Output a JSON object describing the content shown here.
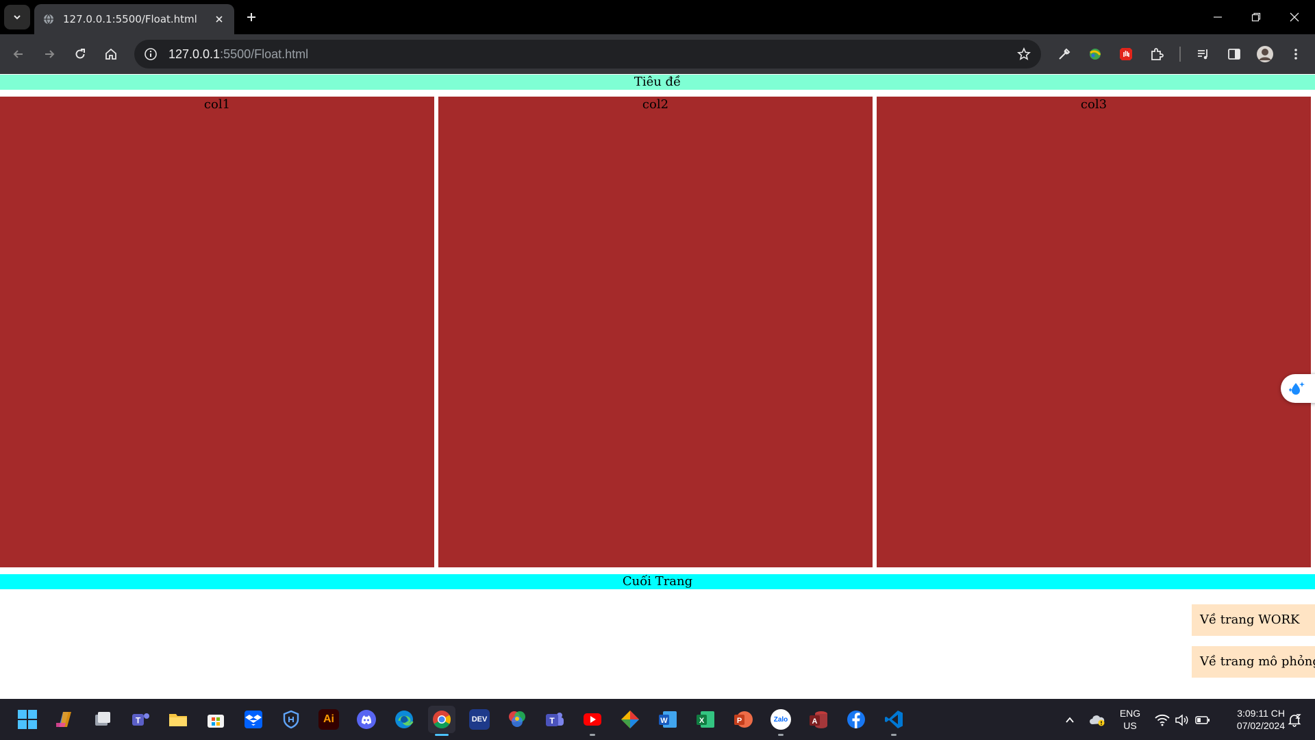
{
  "browser": {
    "tab": {
      "title": "127.0.0.1:5500/Float.html"
    },
    "address_bar": {
      "host": "127.0.0.1",
      "rest": ":5500/Float.html"
    }
  },
  "page": {
    "header": "Tiêu đề",
    "columns": [
      "col1",
      "col2",
      "col3"
    ],
    "footer": "Cuối Trang",
    "links": [
      "Về trang WORK",
      "Về trang mô phỏng"
    ],
    "colors": {
      "header": "#7fffd4",
      "column": "#a52a2a",
      "footer": "#00ffff",
      "link_bg": "#ffe4c4"
    }
  },
  "taskbar": {
    "apps": [
      "windows-start",
      "copilot",
      "task-view",
      "teams",
      "file-explorer",
      "microsoft-store",
      "dropbox",
      "vpn",
      "illustrator",
      "discord",
      "edge",
      "chrome",
      "devtools",
      "color-app",
      "teams-work",
      "youtube",
      "git",
      "word",
      "excel",
      "powerpoint",
      "zalo",
      "access",
      "facebook",
      "vscode"
    ],
    "labels": {
      "illustrator": "Ai",
      "devtools": "DEV",
      "zalo": "Zalo"
    },
    "language": {
      "line1": "ENG",
      "line2": "US"
    },
    "clock": {
      "time": "3:09:11 CH",
      "date": "07/02/2024"
    }
  }
}
